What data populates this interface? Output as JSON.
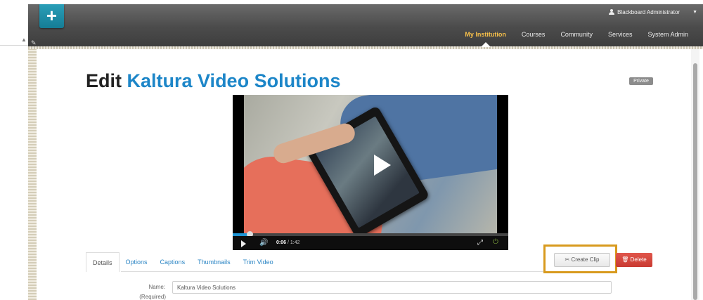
{
  "header": {
    "user_name": "Blackboard Administrator",
    "nav_items": [
      {
        "label": "My Institution"
      },
      {
        "label": "Courses"
      },
      {
        "label": "Community"
      },
      {
        "label": "Services"
      },
      {
        "label": "System Admin"
      }
    ],
    "active_nav": "My Institution",
    "accent_color": "#f7c04a"
  },
  "page": {
    "title_prefix": "Edit",
    "title_name": "Kaltura Video Solutions",
    "badge": "Private"
  },
  "player": {
    "current_time": "0:06",
    "duration": "1:42",
    "progress": 0.06
  },
  "tabs": [
    {
      "label": "Details",
      "active": true
    },
    {
      "label": "Options"
    },
    {
      "label": "Captions"
    },
    {
      "label": "Thumbnails"
    },
    {
      "label": "Trim Video"
    }
  ],
  "actions": {
    "create_clip": "Create Clip",
    "delete": "Delete"
  },
  "form": {
    "name_label": "Name:",
    "required_label": "(Required)",
    "name_value": "Kaltura Video Solutions"
  },
  "colors": {
    "title_accent": "#1d86c8",
    "delete_red": "#c93a31",
    "highlight": "#d89a1e"
  }
}
